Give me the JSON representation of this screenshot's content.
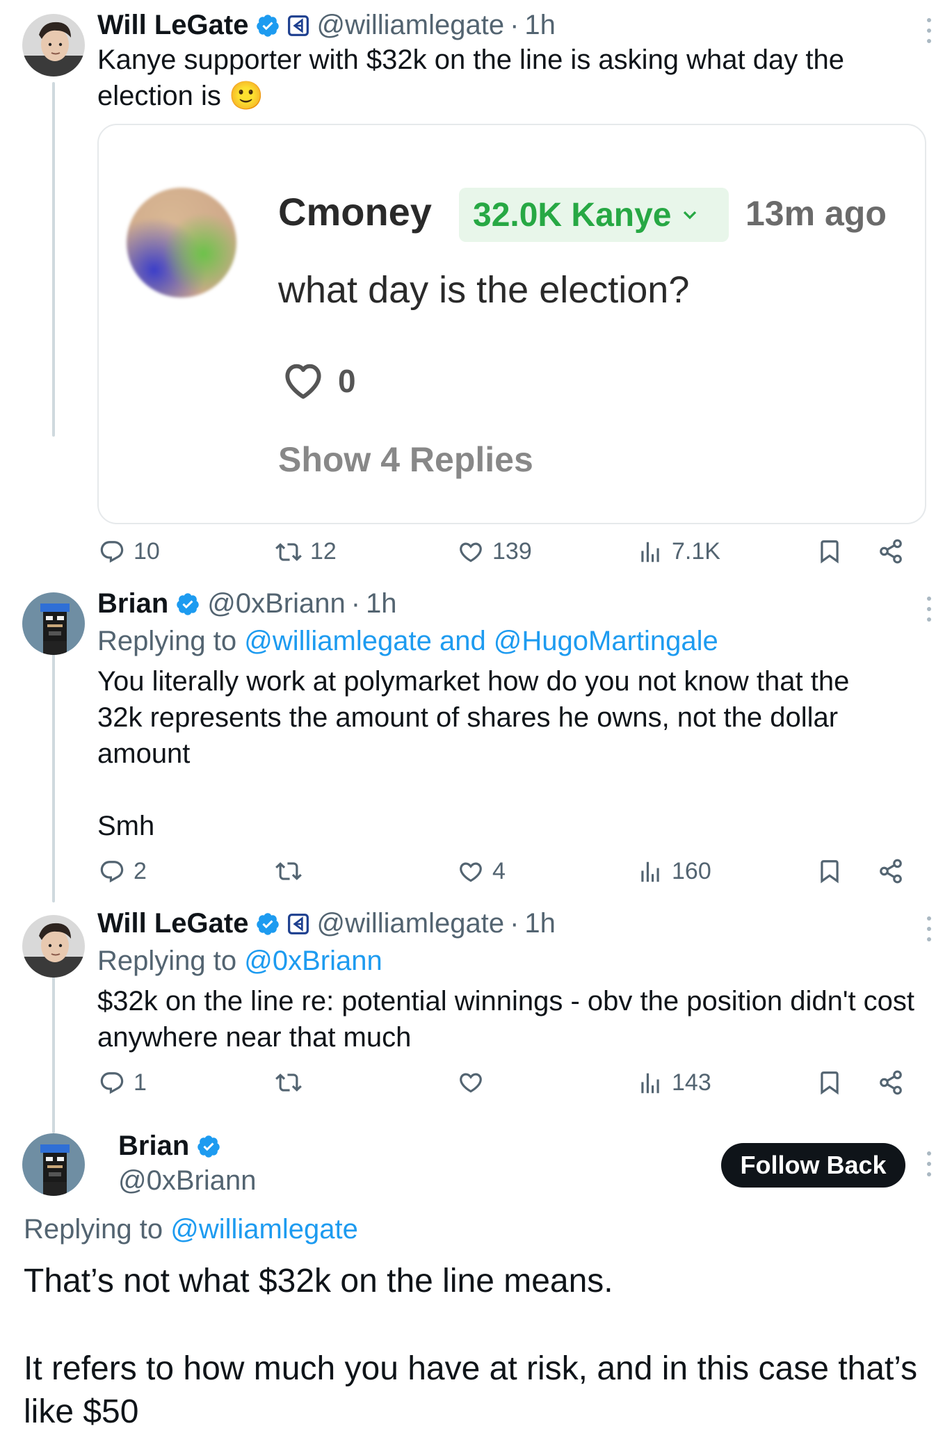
{
  "tweets": [
    {
      "name": "Will LeGate",
      "handle": "@williamlegate",
      "time": "1h",
      "text_line1": "Kanye supporter with $32k on the line is asking what day the",
      "text_line2": "election is",
      "emoji": "🙂",
      "stats": {
        "replies": "10",
        "retweets": "12",
        "likes": "139",
        "views": "7.1K"
      }
    },
    {
      "name": "Brian",
      "handle": "@0xBriann",
      "time": "1h",
      "replying_label": "Replying to",
      "replying_to": "@williamlegate and @HugoMartingale",
      "text": "You literally work at polymarket how do you not know that the 32k represents the amount of shares he owns, not the dollar amount",
      "text2": "Smh",
      "stats": {
        "replies": "2",
        "retweets": "",
        "likes": "4",
        "views": "160"
      }
    },
    {
      "name": "Will LeGate",
      "handle": "@williamlegate",
      "time": "1h",
      "replying_label": "Replying to",
      "replying_to": "@0xBriann",
      "text": "$32k on the line re: potential winnings - obv the position didn't cost anywhere near that much",
      "stats": {
        "replies": "1",
        "retweets": "",
        "likes": "",
        "views": "143"
      }
    }
  ],
  "embed": {
    "user": "Cmoney",
    "position": "32.0K Kanye",
    "time": "13m ago",
    "comment": "what day is the election?",
    "likes": "0",
    "show_replies": "Show 4 Replies"
  },
  "main_tweet": {
    "name": "Brian",
    "handle": "@0xBriann",
    "follow_label": "Follow Back",
    "replying_label": "Replying to",
    "replying_to": "@williamlegate",
    "text1": "That’s not what $32k on the line means.",
    "text2": "It refers to how much you have at risk, and in this case that’s like $50"
  },
  "colors": {
    "link": "#1d9bf0",
    "verified": "#1d9bf0",
    "position_bg": "#e8f6ea",
    "position_text": "#27a844"
  }
}
